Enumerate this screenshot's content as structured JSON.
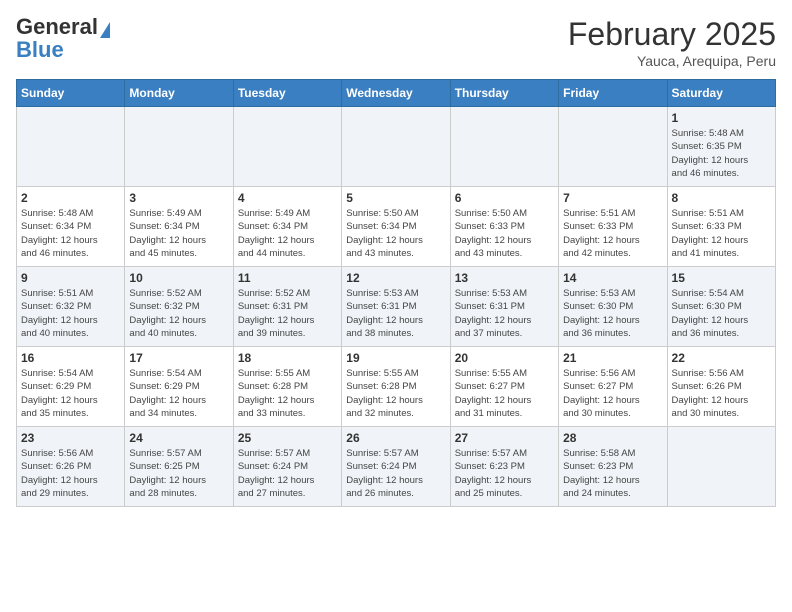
{
  "header": {
    "logo_general": "General",
    "logo_blue": "Blue",
    "month_year": "February 2025",
    "location": "Yauca, Arequipa, Peru"
  },
  "days_of_week": [
    "Sunday",
    "Monday",
    "Tuesday",
    "Wednesday",
    "Thursday",
    "Friday",
    "Saturday"
  ],
  "weeks": [
    [
      {
        "day": null,
        "info": null
      },
      {
        "day": null,
        "info": null
      },
      {
        "day": null,
        "info": null
      },
      {
        "day": null,
        "info": null
      },
      {
        "day": null,
        "info": null
      },
      {
        "day": null,
        "info": null
      },
      {
        "day": "1",
        "info": "Sunrise: 5:48 AM\nSunset: 6:35 PM\nDaylight: 12 hours\nand 46 minutes."
      }
    ],
    [
      {
        "day": "2",
        "info": "Sunrise: 5:48 AM\nSunset: 6:34 PM\nDaylight: 12 hours\nand 46 minutes."
      },
      {
        "day": "3",
        "info": "Sunrise: 5:49 AM\nSunset: 6:34 PM\nDaylight: 12 hours\nand 45 minutes."
      },
      {
        "day": "4",
        "info": "Sunrise: 5:49 AM\nSunset: 6:34 PM\nDaylight: 12 hours\nand 44 minutes."
      },
      {
        "day": "5",
        "info": "Sunrise: 5:50 AM\nSunset: 6:34 PM\nDaylight: 12 hours\nand 43 minutes."
      },
      {
        "day": "6",
        "info": "Sunrise: 5:50 AM\nSunset: 6:33 PM\nDaylight: 12 hours\nand 43 minutes."
      },
      {
        "day": "7",
        "info": "Sunrise: 5:51 AM\nSunset: 6:33 PM\nDaylight: 12 hours\nand 42 minutes."
      },
      {
        "day": "8",
        "info": "Sunrise: 5:51 AM\nSunset: 6:33 PM\nDaylight: 12 hours\nand 41 minutes."
      }
    ],
    [
      {
        "day": "9",
        "info": "Sunrise: 5:51 AM\nSunset: 6:32 PM\nDaylight: 12 hours\nand 40 minutes."
      },
      {
        "day": "10",
        "info": "Sunrise: 5:52 AM\nSunset: 6:32 PM\nDaylight: 12 hours\nand 40 minutes."
      },
      {
        "day": "11",
        "info": "Sunrise: 5:52 AM\nSunset: 6:31 PM\nDaylight: 12 hours\nand 39 minutes."
      },
      {
        "day": "12",
        "info": "Sunrise: 5:53 AM\nSunset: 6:31 PM\nDaylight: 12 hours\nand 38 minutes."
      },
      {
        "day": "13",
        "info": "Sunrise: 5:53 AM\nSunset: 6:31 PM\nDaylight: 12 hours\nand 37 minutes."
      },
      {
        "day": "14",
        "info": "Sunrise: 5:53 AM\nSunset: 6:30 PM\nDaylight: 12 hours\nand 36 minutes."
      },
      {
        "day": "15",
        "info": "Sunrise: 5:54 AM\nSunset: 6:30 PM\nDaylight: 12 hours\nand 36 minutes."
      }
    ],
    [
      {
        "day": "16",
        "info": "Sunrise: 5:54 AM\nSunset: 6:29 PM\nDaylight: 12 hours\nand 35 minutes."
      },
      {
        "day": "17",
        "info": "Sunrise: 5:54 AM\nSunset: 6:29 PM\nDaylight: 12 hours\nand 34 minutes."
      },
      {
        "day": "18",
        "info": "Sunrise: 5:55 AM\nSunset: 6:28 PM\nDaylight: 12 hours\nand 33 minutes."
      },
      {
        "day": "19",
        "info": "Sunrise: 5:55 AM\nSunset: 6:28 PM\nDaylight: 12 hours\nand 32 minutes."
      },
      {
        "day": "20",
        "info": "Sunrise: 5:55 AM\nSunset: 6:27 PM\nDaylight: 12 hours\nand 31 minutes."
      },
      {
        "day": "21",
        "info": "Sunrise: 5:56 AM\nSunset: 6:27 PM\nDaylight: 12 hours\nand 30 minutes."
      },
      {
        "day": "22",
        "info": "Sunrise: 5:56 AM\nSunset: 6:26 PM\nDaylight: 12 hours\nand 30 minutes."
      }
    ],
    [
      {
        "day": "23",
        "info": "Sunrise: 5:56 AM\nSunset: 6:26 PM\nDaylight: 12 hours\nand 29 minutes."
      },
      {
        "day": "24",
        "info": "Sunrise: 5:57 AM\nSunset: 6:25 PM\nDaylight: 12 hours\nand 28 minutes."
      },
      {
        "day": "25",
        "info": "Sunrise: 5:57 AM\nSunset: 6:24 PM\nDaylight: 12 hours\nand 27 minutes."
      },
      {
        "day": "26",
        "info": "Sunrise: 5:57 AM\nSunset: 6:24 PM\nDaylight: 12 hours\nand 26 minutes."
      },
      {
        "day": "27",
        "info": "Sunrise: 5:57 AM\nSunset: 6:23 PM\nDaylight: 12 hours\nand 25 minutes."
      },
      {
        "day": "28",
        "info": "Sunrise: 5:58 AM\nSunset: 6:23 PM\nDaylight: 12 hours\nand 24 minutes."
      },
      {
        "day": null,
        "info": null
      }
    ]
  ]
}
